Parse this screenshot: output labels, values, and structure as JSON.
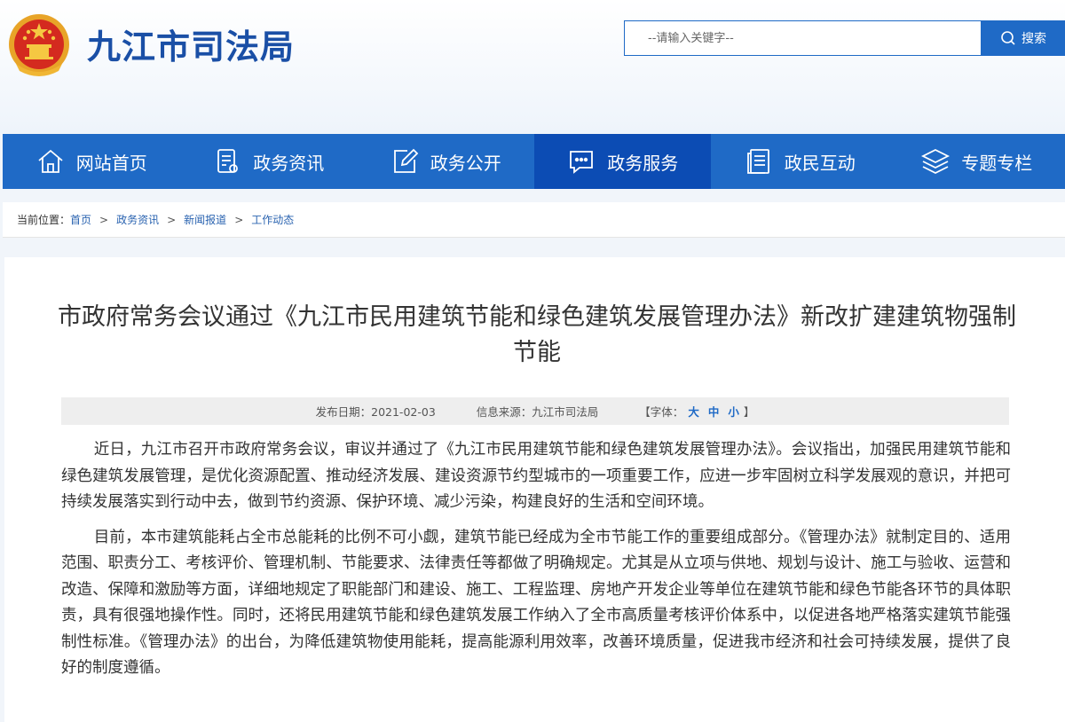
{
  "header": {
    "site_title": "九江市司法局",
    "search_placeholder": "--请输入关键字--",
    "search_button": "搜索"
  },
  "nav": {
    "items": [
      {
        "label": "网站首页",
        "icon": "home-icon"
      },
      {
        "label": "政务资讯",
        "icon": "document-icon"
      },
      {
        "label": "政务公开",
        "icon": "edit-icon"
      },
      {
        "label": "政务服务",
        "icon": "chat-icon",
        "active": true
      },
      {
        "label": "政民互动",
        "icon": "list-icon"
      },
      {
        "label": "专题专栏",
        "icon": "layers-icon"
      }
    ],
    "accent": "#1f6ac6",
    "active_color": "#0c4cb4"
  },
  "breadcrumb": {
    "label": "当前位置：",
    "items": [
      "首页",
      "政务资讯",
      "新闻报道",
      "工作动态"
    ],
    "sep": ">"
  },
  "article": {
    "title": "市政府常务会议通过《九江市民用建筑节能和绿色建筑发展管理办法》新改扩建建筑物强制节能",
    "publish_date": "发布日期：2021-02-03",
    "source": "信息来源：九江市司法局",
    "font_label_open": "【字体：",
    "font_large": "大",
    "font_medium": "中",
    "font_small": "小",
    "font_label_close": "】",
    "paragraphs": [
      "近日，九江市召开市政府常务会议，审议并通过了《九江市民用建筑节能和绿色建筑发展管理办法》。会议指出，加强民用建筑节能和绿色建筑发展管理，是优化资源配置、推动经济发展、建设资源节约型城市的一项重要工作，应进一步牢固树立科学发展观的意识，并把可持续发展落实到行动中去，做到节约资源、保护环境、减少污染，构建良好的生活和空间环境。",
      "目前，本市建筑能耗占全市总能耗的比例不可小觑，建筑节能已经成为全市节能工作的重要组成部分。《管理办法》就制定目的、适用范围、职责分工、考核评价、管理机制、节能要求、法律责任等都做了明确规定。尤其是从立项与供地、规划与设计、施工与验收、运营和改造、保障和激励等方面，详细地规定了职能部门和建设、施工、工程监理、房地产开发企业等单位在建筑节能和绿色节能各环节的具体职责，具有很强地操作性。同时，还将民用建筑节能和绿色建筑发展工作纳入了全市高质量考核评价体系中，以促进各地严格落实建筑节能强制性标准。《管理办法》的出台，为降低建筑物使用能耗，提高能源利用效率，改善环境质量，促进我市经济和社会可持续发展，提供了良好的制度遵循。"
    ]
  }
}
